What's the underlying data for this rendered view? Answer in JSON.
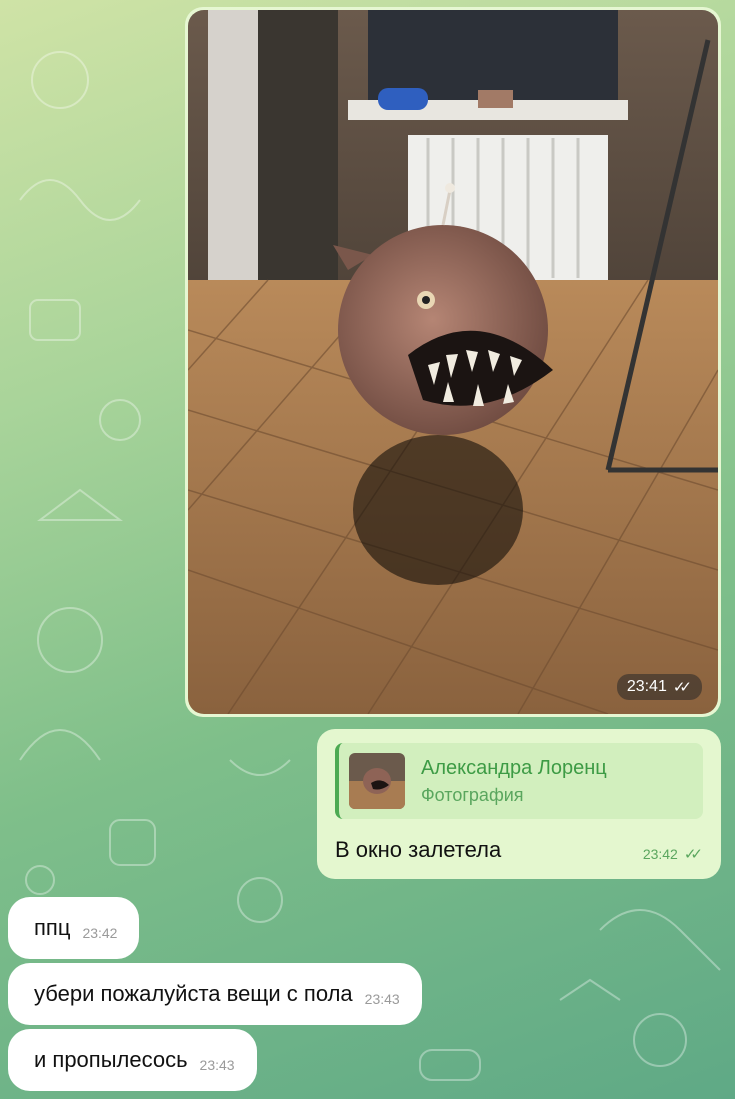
{
  "chat": {
    "messages": [
      {
        "type": "photo",
        "time": "23:41",
        "status": "read",
        "side": "out"
      },
      {
        "type": "reply",
        "side": "out",
        "reply_to": {
          "name": "Александра Лоренц",
          "kind": "Фотография"
        },
        "text": "В окно залетела",
        "time": "23:42",
        "status": "read"
      },
      {
        "type": "text",
        "side": "in",
        "text": "ппц",
        "time": "23:42"
      },
      {
        "type": "text",
        "side": "in",
        "text": "убери пожалуйста вещи с пола",
        "time": "23:43"
      },
      {
        "type": "text",
        "side": "in",
        "text": "и пропылесось",
        "time": "23:43"
      }
    ]
  },
  "icons": {
    "read_status": "double-check-icon"
  },
  "colors": {
    "outgoing_bubble": "#e4f7cf",
    "incoming_bubble": "#ffffff",
    "accent": "#4caa52",
    "background_top": "#cfe3a6",
    "background_bottom": "#5fa986"
  }
}
